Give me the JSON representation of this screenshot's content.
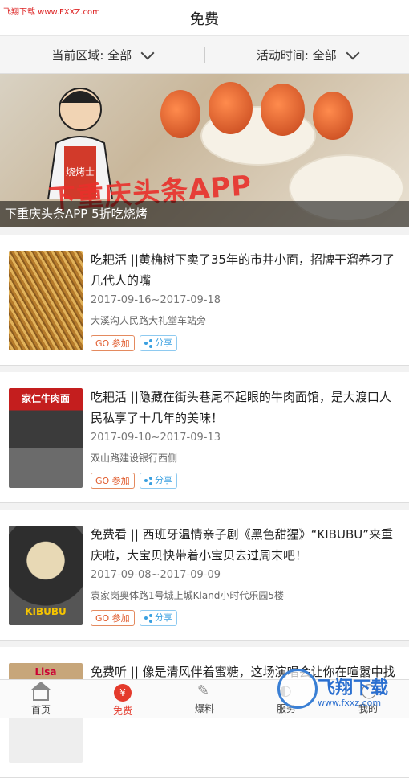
{
  "watermark_top": "飞翔下载 www.FXXZ.com",
  "header": {
    "title": "免费"
  },
  "filters": [
    {
      "label": "当前区域: 全部"
    },
    {
      "label": "活动时间: 全部"
    }
  ],
  "banner": {
    "image_text": "下重庆头条APP",
    "sign_text": "烧烤士",
    "caption": "下重庆头条APP 5折吃烧烤"
  },
  "items": [
    {
      "title": "吃耙活 ||黄桷树下卖了35年的市井小面，招牌干溜养刁了几代人的嘴",
      "date": "2017-09-16~2017-09-18",
      "location": "大溪沟人民路大礼堂车站旁",
      "go_label": "GO 参加",
      "share_label": "分享",
      "thumb_text": ""
    },
    {
      "title": "吃耙活 ||隐藏在街头巷尾不起眼的牛肉面馆，是大渡口人民私享了十几年的美味！",
      "date": "2017-09-10~2017-09-13",
      "location": "双山路建设银行西侧",
      "go_label": "GO 参加",
      "share_label": "分享",
      "thumb_text": "家仁牛肉面"
    },
    {
      "title": "免费看 || 西班牙温情亲子剧《黑色甜猩》“KIBUBU”来重庆啦，大宝贝快带着小宝贝去过周末吧！",
      "date": "2017-09-08~2017-09-09",
      "location": "袁家岗奥体路1号城上城Kland小时代乐园5楼",
      "go_label": "GO 参加",
      "share_label": "分享",
      "thumb_text": "KIBUBU"
    },
    {
      "title": "免费听 || 像是清风伴着蜜糖，这场演唱会让你在喧嚣中找到心灵的避难所！",
      "date": "",
      "location": "",
      "go_label": "",
      "share_label": "",
      "thumb_text": "Lisa"
    }
  ],
  "tabbar": [
    {
      "label": "首页"
    },
    {
      "label": "免费",
      "icon_text": "¥"
    },
    {
      "label": "爆料"
    },
    {
      "label": "服务"
    },
    {
      "label": "我的"
    }
  ],
  "watermark_bottom": {
    "big": "飞翔下载",
    "small": "www.fxxz.com"
  },
  "colors": {
    "accent": "#e43a2c",
    "share": "#3aa0e0"
  }
}
